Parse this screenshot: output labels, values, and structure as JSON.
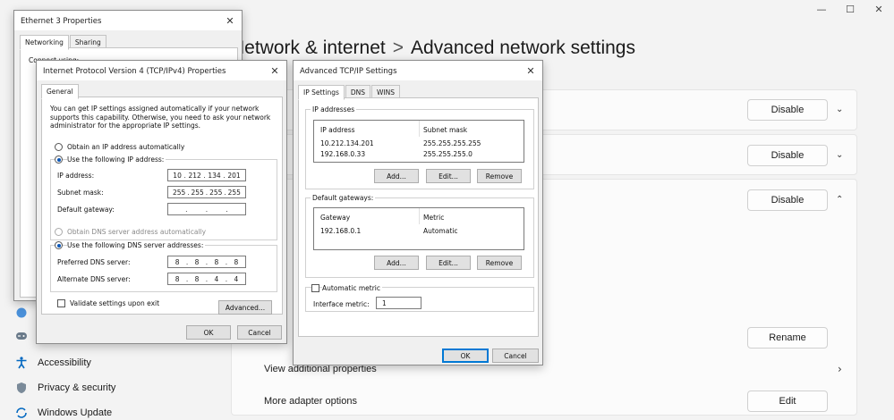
{
  "settings": {
    "title_part1": "Network & internet",
    "title_sep": ">",
    "title_part2": "Advanced network settings",
    "cards": [
      {
        "button": "Disable"
      },
      {
        "button": "Disable"
      },
      {
        "button": "Disable"
      }
    ],
    "rename_button": "Rename",
    "view_additional": "View additional properties",
    "more_adapter": "More adapter options",
    "edit_button": "Edit",
    "nav": [
      {
        "label": "Accessibility",
        "icon": "accessibility-icon"
      },
      {
        "label": "Privacy & security",
        "icon": "shield-icon"
      },
      {
        "label": "Windows Update",
        "icon": "windows-update-icon"
      }
    ],
    "accent": "#0067c0"
  },
  "ethernet_props": {
    "title": "Ethernet 3 Properties",
    "tabs": [
      "Networking",
      "Sharing"
    ],
    "connect_label": "Connect using:"
  },
  "ipv4": {
    "title": "Internet Protocol Version 4 (TCP/IPv4) Properties",
    "tab": "General",
    "description": "You can get IP settings assigned automatically if your network supports this capability. Otherwise, you need to ask your network administrator for the appropriate IP settings.",
    "obtain_auto": "Obtain an IP address automatically",
    "use_following": "Use the following IP address:",
    "ip_label": "IP address:",
    "ip_value": [
      "10",
      "212",
      "134",
      "201"
    ],
    "subnet_label": "Subnet mask:",
    "subnet_value": [
      "255",
      "255",
      "255",
      "255"
    ],
    "gateway_label": "Default gateway:",
    "gateway_value": [
      "",
      "",
      "",
      ""
    ],
    "dns_auto": "Obtain DNS server address automatically",
    "dns_use_following": "Use the following DNS server addresses:",
    "preferred_label": "Preferred DNS server:",
    "preferred_value": [
      "8",
      "8",
      "8",
      "8"
    ],
    "alternate_label": "Alternate DNS server:",
    "alternate_value": [
      "8",
      "8",
      "4",
      "4"
    ],
    "validate": "Validate settings upon exit",
    "advanced": "Advanced...",
    "ok": "OK",
    "cancel": "Cancel"
  },
  "advanced": {
    "title": "Advanced TCP/IP Settings",
    "tabs": [
      "IP Settings",
      "DNS",
      "WINS"
    ],
    "ip_group": "IP addresses",
    "ip_columns": [
      "IP address",
      "Subnet mask"
    ],
    "ip_rows": [
      [
        "10.212.134.201",
        "255.255.255.255"
      ],
      [
        "192.168.0.33",
        "255.255.255.0"
      ]
    ],
    "gw_group": "Default gateways:",
    "gw_columns": [
      "Gateway",
      "Metric"
    ],
    "gw_rows": [
      [
        "192.168.0.1",
        "Automatic"
      ]
    ],
    "add": "Add...",
    "edit": "Edit...",
    "remove": "Remove",
    "auto_metric": "Automatic metric",
    "interface_metric_label": "Interface metric:",
    "interface_metric_value": "1",
    "ok": "OK",
    "cancel": "Cancel"
  }
}
